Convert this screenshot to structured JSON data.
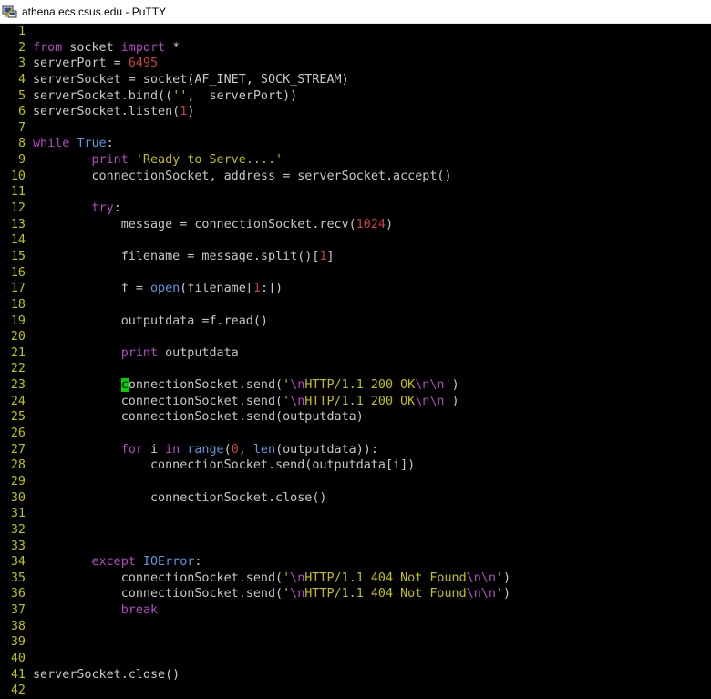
{
  "window": {
    "title": "athena.ecs.csus.edu - PuTTY",
    "icon": "putty-icon"
  },
  "colors": {
    "background": "#000000",
    "line_number": "#c2c300",
    "text": "#c7c7c7",
    "keyword": "#b448c5",
    "builtin": "#5b9ae3",
    "string": "#c2c300",
    "escape": "#b448c5",
    "number": "#c94040",
    "cursor": "#00d100"
  },
  "editor": {
    "cursor_line": 23,
    "lines": [
      {
        "n": "1",
        "tokens": []
      },
      {
        "n": "2",
        "tokens": [
          [
            "kw",
            "from"
          ],
          [
            "t",
            " socket "
          ],
          [
            "kw",
            "import"
          ],
          [
            "t",
            " *"
          ]
        ]
      },
      {
        "n": "3",
        "tokens": [
          [
            "t",
            "serverPort = "
          ],
          [
            "num",
            "6495"
          ]
        ]
      },
      {
        "n": "4",
        "tokens": [
          [
            "t",
            "serverSocket = socket(AF_INET, SOCK_STREAM)"
          ]
        ]
      },
      {
        "n": "5",
        "tokens": [
          [
            "t",
            "serverSocket.bind(("
          ],
          [
            "str",
            "''"
          ],
          [
            "t",
            ",  serverPort))"
          ]
        ]
      },
      {
        "n": "6",
        "tokens": [
          [
            "t",
            "serverSocket.listen("
          ],
          [
            "num",
            "1"
          ],
          [
            "t",
            ")"
          ]
        ]
      },
      {
        "n": "7",
        "tokens": []
      },
      {
        "n": "8",
        "tokens": [
          [
            "kw",
            "while"
          ],
          [
            "t",
            " "
          ],
          [
            "bi",
            "True"
          ],
          [
            "t",
            ":"
          ]
        ]
      },
      {
        "n": "9",
        "tokens": [
          [
            "t",
            "        "
          ],
          [
            "kw",
            "print"
          ],
          [
            "t",
            " "
          ],
          [
            "str",
            "'Ready to Serve....'"
          ]
        ]
      },
      {
        "n": "10",
        "tokens": [
          [
            "t",
            "        connectionSocket, address = serverSocket.accept()"
          ]
        ]
      },
      {
        "n": "11",
        "tokens": []
      },
      {
        "n": "12",
        "tokens": [
          [
            "t",
            "        "
          ],
          [
            "kw",
            "try"
          ],
          [
            "t",
            ":"
          ]
        ]
      },
      {
        "n": "13",
        "tokens": [
          [
            "t",
            "            message = connectionSocket.recv("
          ],
          [
            "num",
            "1024"
          ],
          [
            "t",
            ")"
          ]
        ]
      },
      {
        "n": "14",
        "tokens": []
      },
      {
        "n": "15",
        "tokens": [
          [
            "t",
            "            filename = message.split()["
          ],
          [
            "num",
            "1"
          ],
          [
            "t",
            "]"
          ]
        ]
      },
      {
        "n": "16",
        "tokens": []
      },
      {
        "n": "17",
        "tokens": [
          [
            "t",
            "            f = "
          ],
          [
            "bi",
            "open"
          ],
          [
            "t",
            "(filename["
          ],
          [
            "num",
            "1"
          ],
          [
            "t",
            ":])"
          ]
        ]
      },
      {
        "n": "18",
        "tokens": []
      },
      {
        "n": "19",
        "tokens": [
          [
            "t",
            "            outputdata =f.read()"
          ]
        ]
      },
      {
        "n": "20",
        "tokens": []
      },
      {
        "n": "21",
        "tokens": [
          [
            "t",
            "            "
          ],
          [
            "kw",
            "print"
          ],
          [
            "t",
            " outputdata"
          ]
        ]
      },
      {
        "n": "22",
        "tokens": []
      },
      {
        "n": "23",
        "tokens": [
          [
            "t",
            "            "
          ],
          [
            "cur",
            "c"
          ],
          [
            "t",
            "onnectionSocket.send("
          ],
          [
            "str",
            "'"
          ],
          [
            "esc",
            "\\n"
          ],
          [
            "str",
            "HTTP/1.1 200 OK"
          ],
          [
            "esc",
            "\\n\\n"
          ],
          [
            "str",
            "'"
          ],
          [
            "t",
            ")"
          ]
        ]
      },
      {
        "n": "24",
        "tokens": [
          [
            "t",
            "            connectionSocket.send("
          ],
          [
            "str",
            "'"
          ],
          [
            "esc",
            "\\n"
          ],
          [
            "str",
            "HTTP/1.1 200 OK"
          ],
          [
            "esc",
            "\\n\\n"
          ],
          [
            "str",
            "'"
          ],
          [
            "t",
            ")"
          ]
        ]
      },
      {
        "n": "25",
        "tokens": [
          [
            "t",
            "            connectionSocket.send(outputdata)"
          ]
        ]
      },
      {
        "n": "26",
        "tokens": []
      },
      {
        "n": "27",
        "tokens": [
          [
            "t",
            "            "
          ],
          [
            "kw",
            "for"
          ],
          [
            "t",
            " i "
          ],
          [
            "kw",
            "in"
          ],
          [
            "t",
            " "
          ],
          [
            "bi",
            "range"
          ],
          [
            "t",
            "("
          ],
          [
            "num",
            "0"
          ],
          [
            "t",
            ", "
          ],
          [
            "bi",
            "len"
          ],
          [
            "t",
            "(outputdata)):"
          ]
        ]
      },
      {
        "n": "28",
        "tokens": [
          [
            "t",
            "                connectionSocket.send(outputdata[i])"
          ]
        ]
      },
      {
        "n": "29",
        "tokens": []
      },
      {
        "n": "30",
        "tokens": [
          [
            "t",
            "                connectionSocket.close()"
          ]
        ]
      },
      {
        "n": "31",
        "tokens": []
      },
      {
        "n": "32",
        "tokens": []
      },
      {
        "n": "33",
        "tokens": []
      },
      {
        "n": "34",
        "tokens": [
          [
            "t",
            "        "
          ],
          [
            "kw",
            "except"
          ],
          [
            "t",
            " "
          ],
          [
            "bi",
            "IOError"
          ],
          [
            "t",
            ":"
          ]
        ]
      },
      {
        "n": "35",
        "tokens": [
          [
            "t",
            "            connectionSocket.send("
          ],
          [
            "str",
            "'"
          ],
          [
            "esc",
            "\\n"
          ],
          [
            "str",
            "HTTP/1.1 404 Not Found"
          ],
          [
            "esc",
            "\\n\\n"
          ],
          [
            "str",
            "'"
          ],
          [
            "t",
            ")"
          ]
        ]
      },
      {
        "n": "36",
        "tokens": [
          [
            "t",
            "            connectionSocket.send("
          ],
          [
            "str",
            "'"
          ],
          [
            "esc",
            "\\n"
          ],
          [
            "str",
            "HTTP/1.1 404 Not Found"
          ],
          [
            "esc",
            "\\n\\n"
          ],
          [
            "str",
            "'"
          ],
          [
            "t",
            ")"
          ]
        ]
      },
      {
        "n": "37",
        "tokens": [
          [
            "t",
            "            "
          ],
          [
            "kw",
            "break"
          ]
        ]
      },
      {
        "n": "38",
        "tokens": []
      },
      {
        "n": "39",
        "tokens": []
      },
      {
        "n": "40",
        "tokens": []
      },
      {
        "n": "41",
        "tokens": [
          [
            "t",
            "serverSocket.close()"
          ]
        ]
      },
      {
        "n": "42",
        "tokens": []
      }
    ]
  }
}
